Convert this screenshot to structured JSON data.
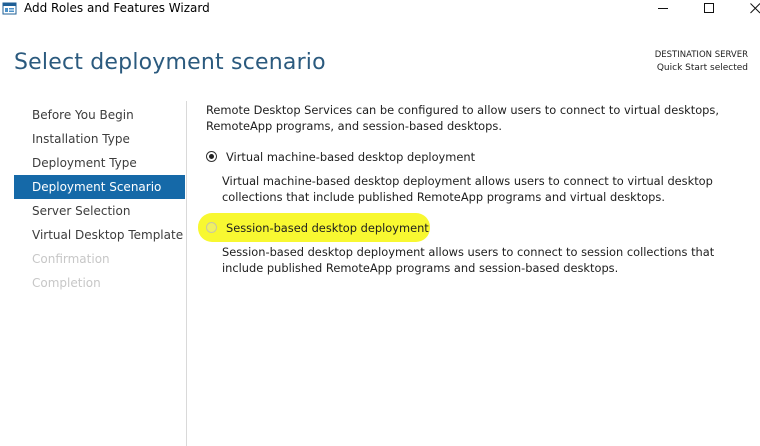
{
  "window": {
    "title": "Add Roles and Features Wizard"
  },
  "header": {
    "title": "Select deployment scenario",
    "destination_label": "DESTINATION SERVER",
    "destination_value": "Quick Start selected"
  },
  "nav": {
    "items": [
      {
        "label": "Before You Begin",
        "state": "normal"
      },
      {
        "label": "Installation Type",
        "state": "normal"
      },
      {
        "label": "Deployment Type",
        "state": "normal"
      },
      {
        "label": "Deployment Scenario",
        "state": "selected"
      },
      {
        "label": "Server Selection",
        "state": "normal"
      },
      {
        "label": "Virtual Desktop Template",
        "state": "normal"
      },
      {
        "label": "Confirmation",
        "state": "disabled"
      },
      {
        "label": "Completion",
        "state": "disabled"
      }
    ]
  },
  "main": {
    "intro": "Remote Desktop Services can be configured to allow users to connect to virtual desktops, RemoteApp programs, and session-based desktops.",
    "options": [
      {
        "label": "Virtual machine-based desktop deployment",
        "selected": true,
        "description": "Virtual machine-based desktop deployment allows users to connect to virtual desktop collections that include published RemoteApp programs and virtual desktops."
      },
      {
        "label": "Session-based desktop deployment",
        "selected": false,
        "highlighted": true,
        "description": "Session-based desktop deployment allows users to connect to session collections that include published RemoteApp programs and session-based desktops."
      }
    ]
  },
  "colors": {
    "accent": "#1569a8",
    "title": "#2b5a7e",
    "highlight": "#f7f720",
    "disabled_text": "#c7c7c7"
  },
  "icons": {
    "app": "server-manager-icon",
    "minimize": "minimize-icon",
    "maximize": "maximize-icon",
    "close": "close-icon"
  }
}
